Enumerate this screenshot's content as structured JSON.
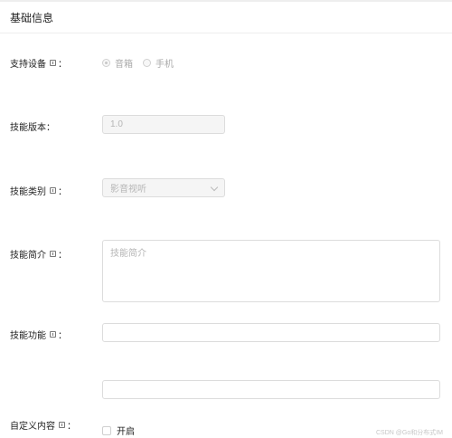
{
  "section": {
    "title": "基础信息"
  },
  "fields": {
    "devices": {
      "label": "支持设备",
      "colon": "：",
      "options": [
        {
          "label": "音箱",
          "checked": true
        },
        {
          "label": "手机",
          "checked": false
        }
      ]
    },
    "version": {
      "label": "技能版本",
      "colon": "：",
      "value": "1.0"
    },
    "category": {
      "label": "技能类别",
      "colon": "：",
      "value": "影音视听"
    },
    "intro": {
      "label": "技能简介",
      "colon": "：",
      "placeholder": "技能简介"
    },
    "features": {
      "label": "技能功能",
      "colon": "："
    },
    "custom": {
      "label": "自定义内容",
      "colon": "：",
      "checkbox_label": "开启"
    }
  },
  "watermark": "CSDN @Go和分布式IM",
  "colors": {
    "border": "#dcdcdc",
    "disabled_bg": "#f5f5f5",
    "text": "#222222",
    "muted": "#b5b5b5"
  }
}
